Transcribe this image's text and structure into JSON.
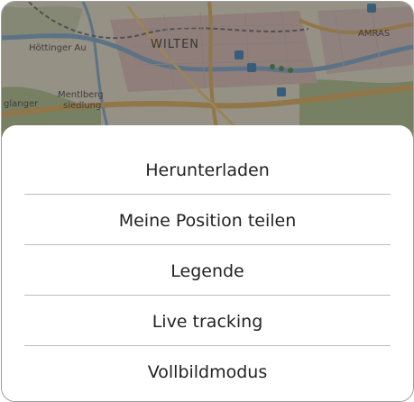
{
  "map": {
    "labels": {
      "hottinger_au": "Höttinger Au",
      "wilten": "WILTEN",
      "amras": "AMRAS",
      "menteberg": "Mentlberg",
      "siedlung": "siedlung",
      "glanger": "glanger"
    },
    "icons": [
      "parking-icon",
      "info-icon",
      "parking-icon",
      "parking-icon"
    ]
  },
  "sheet": {
    "items": [
      {
        "label": "Herunterladen"
      },
      {
        "label": "Meine Position teilen"
      },
      {
        "label": "Legende"
      },
      {
        "label": "Live tracking"
      },
      {
        "label": "Vollbildmodus"
      }
    ]
  },
  "colors": {
    "overlay": "#464646",
    "sheet_bg": "#ffffff",
    "text": "#222222",
    "divider": "#bdbdbd",
    "map_road": "#c79a4b",
    "map_water": "#6d95b5",
    "map_forest": "#8ba06b"
  }
}
